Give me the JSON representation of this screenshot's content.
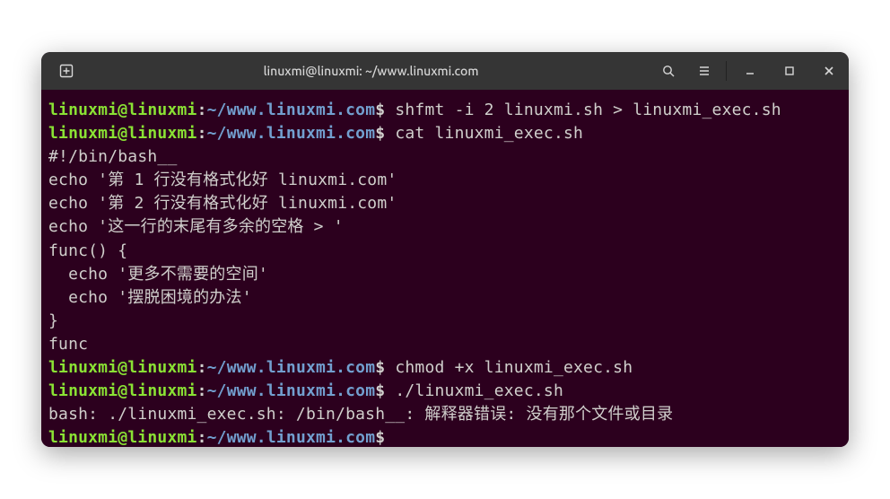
{
  "titlebar": {
    "title": "linuxmi@linuxmi: ~/www.linuxmi.com"
  },
  "prompt": {
    "user": "linuxmi",
    "at": "@",
    "host": "linuxmi",
    "colon": ":",
    "path": "~/www.linuxmi.com",
    "dollar": "$"
  },
  "lines": {
    "cmd1": " shfmt -i 2 linuxmi.sh > linuxmi_exec.sh",
    "cmd2": " cat linuxmi_exec.sh",
    "out1": "#!/bin/bash__",
    "out2": "echo '第 1 行没有格式化好 linuxmi.com'",
    "out3": "echo '第 2 行没有格式化好 linuxmi.com'",
    "out4": "echo '这一行的末尾有多余的空格 > '",
    "out5": "func() {",
    "out6": "  echo '更多不需要的空间'",
    "out7": "  echo '摆脱困境的办法'",
    "out8": "}",
    "out9": "func",
    "cmd3": " chmod +x linuxmi_exec.sh",
    "cmd4": " ./linuxmi_exec.sh",
    "out10": "bash: ./linuxmi_exec.sh: /bin/bash__: 解释器错误: 没有那个文件或目录",
    "cmd5": " "
  }
}
